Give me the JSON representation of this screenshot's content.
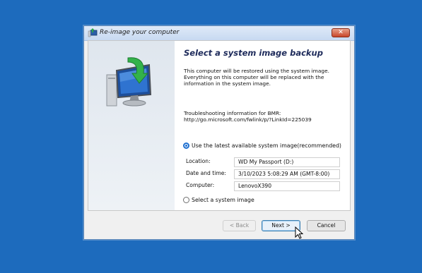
{
  "window": {
    "title": "Re-image your computer",
    "close_label": "✕"
  },
  "main": {
    "heading": "Select a system image backup",
    "description": "This computer will be restored using the system image. Everything on this computer will be replaced with the information in the system image.",
    "troubleshoot_label": "Troubleshooting information for BMR:",
    "troubleshoot_link": "http://go.microsoft.com/fwlink/p/?LinkId=225039",
    "option_latest": "Use the latest available system image(recommended)",
    "option_select": "Select a system image",
    "fields": {
      "location_label": "Location:",
      "location_value": "WD My Passport (D:)",
      "datetime_label": "Date and time:",
      "datetime_value": "3/10/2023 5:08:29 AM (GMT-8:00)",
      "computer_label": "Computer:",
      "computer_value": "LenovoX390"
    },
    "selected_option": "latest"
  },
  "buttons": {
    "back": "< Back",
    "next": "Next >",
    "cancel": "Cancel"
  },
  "colors": {
    "desktop": "#1d6bbd",
    "heading": "#1d2a5a",
    "radio_accent": "#1e6fd0"
  }
}
